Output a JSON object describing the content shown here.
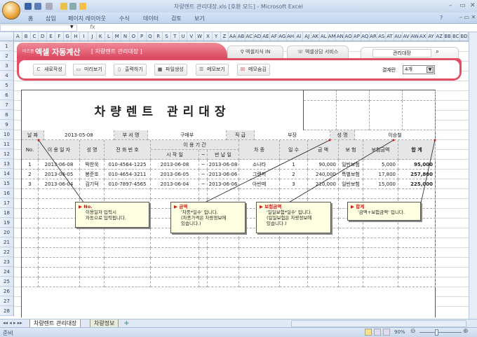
{
  "window": {
    "title": "차량렌트 관리대장.xls  [호환 모드] - Microsoft Excel"
  },
  "ribbon_tabs": [
    "홈",
    "삽입",
    "페이지 레이아웃",
    "수식",
    "데이터",
    "검토",
    "보기"
  ],
  "formula_bar": {
    "fx": "fx",
    "name_box": ""
  },
  "columns": [
    "A",
    "B",
    "C",
    "D",
    "E",
    "F",
    "G",
    "H",
    "I",
    "J",
    "K",
    "L",
    "M",
    "N",
    "O",
    "P",
    "Q",
    "R",
    "S",
    "T",
    "U",
    "V",
    "W",
    "X",
    "Y",
    "Z",
    "AA",
    "AB",
    "AC",
    "AD",
    "AE",
    "AF",
    "AG",
    "AH",
    "AI",
    "AJ",
    "AK",
    "AL",
    "AM",
    "AN",
    "AO",
    "AP",
    "AQ",
    "AR",
    "AS",
    "AT",
    "AU",
    "AV",
    "AW",
    "AX",
    "AY",
    "AZ",
    "BB",
    "BC",
    "BD"
  ],
  "rows": [
    "1",
    "2",
    "3",
    "4",
    "5",
    "6",
    "7",
    "8",
    "9",
    "10",
    "11",
    "12",
    "13",
    "14",
    "15",
    "16",
    "17",
    "18",
    "19",
    "20",
    "21",
    "22",
    "23",
    "24",
    "25",
    "26",
    "27",
    "28"
  ],
  "banner": {
    "brand_small": "비즈폼",
    "brand": "엑셀 자동계산",
    "subtitle": "[ 차량렌트 관리대장 ]",
    "tab1": "엑셀지식 IN",
    "tab2": "엑셀상담 서비스",
    "search_value": "관리대장"
  },
  "toolbar": {
    "buttons": [
      "새로작성",
      "미리보기",
      "출력하기",
      "파일생성",
      "메모보기",
      "메모숨김"
    ],
    "approval_label": "결재란",
    "approval_value": "4개"
  },
  "sheet": {
    "title": "차량렌트 관리대장",
    "info": {
      "date_label": "날 짜",
      "date": "2013-05-08",
      "dept_label": "부 서 명",
      "dept": "구매부",
      "rank_label": "직 급",
      "rank": "부장",
      "name_label": "성 명",
      "name": "이승철"
    },
    "headers": {
      "no": "No.",
      "use_date": "이 용 일 자",
      "name": "성  명",
      "phone": "전 화 번 호",
      "period": "이   용   기   간",
      "start": "시 작 일",
      "tilde": "~",
      "end": "반 납 일",
      "car": "차  종",
      "days": "일 수",
      "amount": "금   액",
      "insurance": "보  험",
      "ins_amount": "보험금액",
      "total": "합     계"
    },
    "records": [
      {
        "no": "1",
        "use_date": "2013-06-08",
        "name": "박찬욱",
        "phone": "010-4564-1225",
        "start": "2013-06-08",
        "tilde": "~",
        "end": "2013-06-08",
        "car": "소나타",
        "days": "1",
        "amount": "90,000",
        "insurance": "일반보험",
        "ins_amount": "5,000",
        "total": "95,000"
      },
      {
        "no": "2",
        "use_date": "2013-06-05",
        "name": "봉준호",
        "phone": "010-4654-3211",
        "start": "2013-06-05",
        "tilde": "~",
        "end": "2013-06-06",
        "car": "그랜저",
        "days": "2",
        "amount": "240,000",
        "insurance": "특별보험",
        "ins_amount": "17,800",
        "total": "257,800"
      },
      {
        "no": "3",
        "use_date": "2013-06-04",
        "name": "김기덕",
        "phone": "010-7897-4565",
        "start": "2013-06-04",
        "tilde": "~",
        "end": "2013-06-06",
        "car": "아반떼",
        "days": "3",
        "amount": "210,000",
        "insurance": "일반보험",
        "ins_amount": "15,000",
        "total": "225,000"
      }
    ]
  },
  "comments": [
    {
      "title": "No.",
      "lines": [
        "이용일자 입력시",
        "자동으로 입력됩니다."
      ]
    },
    {
      "title": "금액",
      "lines": [
        "'차종*일수' 입니다.",
        "(차종가격은 차량정보에",
        "있습니다.)"
      ]
    },
    {
      "title": "보험금액",
      "lines": [
        "'일일보험*일수' 입니다.",
        "(일일보험은 차량정보에",
        "있습니다.)"
      ]
    },
    {
      "title": "합계",
      "lines": [
        "'금액+보험금액' 입니다."
      ]
    }
  ],
  "sheet_tabs": [
    "차량렌트 관리대장",
    "차량정보"
  ],
  "status": {
    "ready": "준비",
    "zoom": "90%"
  },
  "colors": {
    "accent": "#e24e63",
    "comment_title": "#d01818"
  }
}
